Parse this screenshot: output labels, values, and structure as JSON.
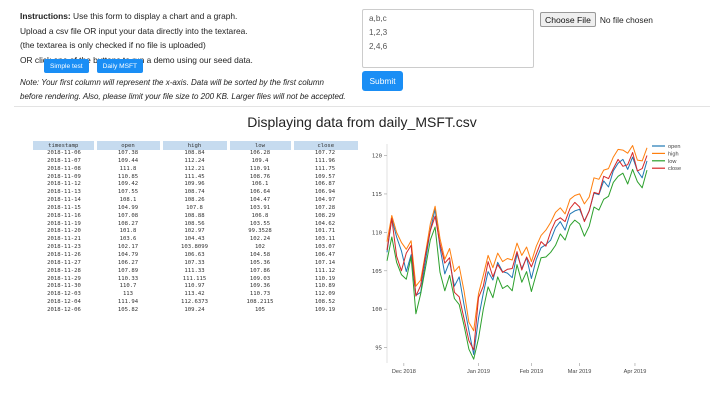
{
  "instructions": {
    "bold": "Instructions:",
    "line1": " Use this form to display a chart and a graph.",
    "line2": "Upload a csv file OR input your data directly into the textarea.",
    "line3": "(the textarea is only checked if no file is uploaded)",
    "line4": "OR click one of the buttons to run a demo using our seed data."
  },
  "buttons": {
    "simple_test": "Simple test",
    "daily_msft": "Daily MSFT",
    "submit": "Submit"
  },
  "note": {
    "line1": "Note: Your first column will represent the x-axis. Data will be sorted by the first column",
    "line2": "before rendering. Also, please limit your file size to 200 KB. Larger files will not be accepted."
  },
  "textarea": {
    "value": "a,b,c\n1,2,3\n2,4,6"
  },
  "file_input": {
    "button": "Choose File",
    "status": "No file chosen"
  },
  "heading": "Displaying data from daily_MSFT.csv",
  "table": {
    "columns": [
      "timestamp",
      "open",
      "high",
      "low",
      "close"
    ],
    "rows": [
      [
        "2018-11-06",
        "107.38",
        "108.84",
        "106.28",
        "107.72"
      ],
      [
        "2018-11-07",
        "109.44",
        "112.24",
        "109.4",
        "111.96"
      ],
      [
        "2018-11-08",
        "111.8",
        "112.21",
        "110.91",
        "111.75"
      ],
      [
        "2018-11-09",
        "110.85",
        "111.45",
        "108.76",
        "109.57"
      ],
      [
        "2018-11-12",
        "109.42",
        "109.96",
        "106.1",
        "106.87"
      ],
      [
        "2018-11-13",
        "107.55",
        "108.74",
        "106.64",
        "106.94"
      ],
      [
        "2018-11-14",
        "108.1",
        "108.26",
        "104.47",
        "104.97"
      ],
      [
        "2018-11-15",
        "104.99",
        "107.8",
        "103.91",
        "107.28"
      ],
      [
        "2018-11-16",
        "107.08",
        "108.88",
        "106.8",
        "108.29"
      ],
      [
        "2018-11-19",
        "108.27",
        "108.56",
        "103.55",
        "104.62"
      ],
      [
        "2018-11-20",
        "101.8",
        "102.97",
        "99.3528",
        "101.71"
      ],
      [
        "2018-11-21",
        "103.6",
        "104.43",
        "102.24",
        "103.11"
      ],
      [
        "2018-11-23",
        "102.17",
        "103.8099",
        "102",
        "103.07"
      ],
      [
        "2018-11-26",
        "104.79",
        "106.63",
        "104.58",
        "106.47"
      ],
      [
        "2018-11-27",
        "106.27",
        "107.33",
        "105.36",
        "107.14"
      ],
      [
        "2018-11-28",
        "107.89",
        "111.33",
        "107.86",
        "111.12"
      ],
      [
        "2018-11-29",
        "110.33",
        "111.115",
        "109.03",
        "110.19"
      ],
      [
        "2018-11-30",
        "110.7",
        "110.97",
        "109.36",
        "110.89"
      ],
      [
        "2018-12-03",
        "113",
        "113.42",
        "110.73",
        "112.09"
      ],
      [
        "2018-12-04",
        "111.94",
        "112.6373",
        "108.2115",
        "108.52"
      ],
      [
        "2018-12-06",
        "105.82",
        "109.24",
        "105",
        "109.19"
      ]
    ]
  },
  "chart_data": {
    "type": "line",
    "title": "",
    "xlabel": "",
    "ylabel": "",
    "ylim": [
      93,
      121.5
    ],
    "y_ticks": [
      95,
      100,
      105,
      110,
      115,
      120
    ],
    "x_ticks": [
      "Dec 2018",
      "Jan 2019",
      "Feb 2019",
      "Mar 2019",
      "Apr 2019"
    ],
    "x_tick_positions": [
      7,
      38,
      60,
      80,
      103
    ],
    "legend_position": "top-right",
    "x": [
      0,
      2,
      4,
      6,
      8,
      10,
      12,
      14,
      16,
      18,
      20,
      22,
      24,
      26,
      28,
      30,
      32,
      34,
      36,
      38,
      40,
      42,
      44,
      46,
      48,
      50,
      52,
      54,
      56,
      58,
      60,
      62,
      64,
      66,
      68,
      70,
      72,
      74,
      76,
      78,
      80,
      82,
      84,
      86,
      88,
      90,
      92,
      94,
      96,
      98,
      100,
      102,
      104,
      106,
      108
    ],
    "series": [
      {
        "name": "open",
        "color": "#1f77b4",
        "values": [
          107.4,
          111.8,
          109.4,
          107.6,
          104.9,
          107.1,
          101.8,
          102.2,
          106.3,
          110.3,
          113.0,
          108.0,
          104.6,
          106.2,
          103.0,
          104.2,
          100.6,
          97.2,
          94.1,
          98.8,
          102.1,
          104.9,
          103.8,
          106.1,
          104.9,
          104.7,
          104.1,
          107.2,
          105.3,
          106.7,
          104.0,
          106.5,
          108.0,
          108.4,
          109.0,
          110.6,
          111.4,
          110.3,
          112.4,
          112.8,
          113.0,
          111.5,
          112.8,
          115.1,
          114.9,
          116.7,
          115.9,
          118.0,
          119.0,
          119.5,
          118.2,
          119.8,
          118.0,
          117.1,
          119.3
        ]
      },
      {
        "name": "high",
        "color": "#ff7f0e",
        "values": [
          108.8,
          112.2,
          110.0,
          108.7,
          107.8,
          108.9,
          103.0,
          103.8,
          107.3,
          111.1,
          113.4,
          109.2,
          106.5,
          107.9,
          104.9,
          105.6,
          102.4,
          98.3,
          97.2,
          102.0,
          104.4,
          107.0,
          105.4,
          107.3,
          106.2,
          106.6,
          106.4,
          108.6,
          107.0,
          108.1,
          106.2,
          108.2,
          109.6,
          110.3,
          111.3,
          112.6,
          113.2,
          112.4,
          114.3,
          114.8,
          115.0,
          113.7,
          114.6,
          117.1,
          116.9,
          118.1,
          118.3,
          119.8,
          120.8,
          120.7,
          120.3,
          121.3,
          119.4,
          119.3,
          121.0
        ]
      },
      {
        "name": "low",
        "color": "#2ca02c",
        "values": [
          106.3,
          109.4,
          106.1,
          104.5,
          103.9,
          106.8,
          99.4,
          102.0,
          105.4,
          109.0,
          110.7,
          104.8,
          102.4,
          104.4,
          101.4,
          100.6,
          97.9,
          94.8,
          93.5,
          96.2,
          100.0,
          102.9,
          101.5,
          104.2,
          102.7,
          103.1,
          102.4,
          105.8,
          103.5,
          104.9,
          102.3,
          104.6,
          106.7,
          106.8,
          107.4,
          108.3,
          109.8,
          109.0,
          110.9,
          111.6,
          111.1,
          109.5,
          110.8,
          113.3,
          112.9,
          114.3,
          114.7,
          116.5,
          117.3,
          117.7,
          116.3,
          118.2,
          116.6,
          115.8,
          118.1
        ]
      },
      {
        "name": "close",
        "color": "#d62728",
        "values": [
          107.7,
          111.8,
          106.9,
          105.0,
          107.3,
          108.3,
          101.7,
          103.1,
          107.1,
          110.2,
          112.1,
          108.5,
          106.0,
          106.7,
          102.2,
          101.6,
          98.8,
          95.9,
          94.7,
          101.5,
          103.0,
          106.2,
          104.2,
          105.8,
          104.8,
          105.2,
          105.3,
          107.5,
          105.1,
          106.8,
          105.5,
          107.2,
          108.8,
          108.2,
          110.1,
          111.5,
          111.9,
          111.4,
          113.1,
          113.9,
          113.3,
          111.4,
          112.8,
          115.2,
          115.0,
          117.3,
          117.0,
          118.3,
          119.5,
          118.6,
          118.8,
          120.4,
          118.0,
          118.3,
          120.0
        ]
      }
    ]
  }
}
